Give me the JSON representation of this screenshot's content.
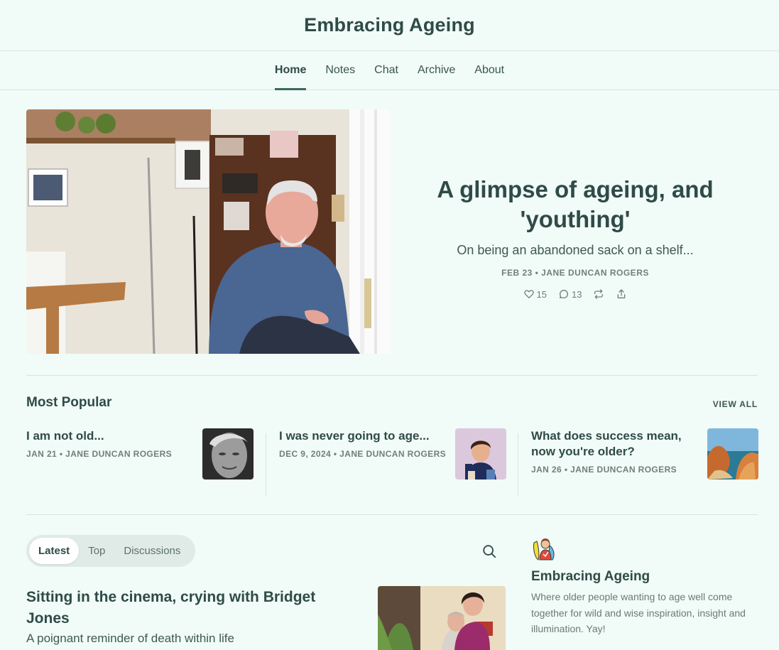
{
  "header": {
    "title": "Embracing Ageing"
  },
  "nav": {
    "items": [
      {
        "label": "Home",
        "active": true
      },
      {
        "label": "Notes"
      },
      {
        "label": "Chat"
      },
      {
        "label": "Archive"
      },
      {
        "label": "About"
      }
    ]
  },
  "hero": {
    "title": "A glimpse of ageing, and 'youthing'",
    "subtitle": "On being an abandoned sack on a shelf...",
    "meta": "FEB 23 • JANE DUNCAN ROGERS",
    "likes": "15",
    "comments": "13",
    "icons": [
      "heart-icon",
      "comment-icon",
      "restack-icon",
      "share-icon"
    ]
  },
  "popular": {
    "heading": "Most Popular",
    "view_all": "VIEW ALL",
    "posts": [
      {
        "title": "I am not old...",
        "meta": "JAN 21 • JANE DUNCAN ROGERS"
      },
      {
        "title": "I was never going to age...",
        "meta": "DEC 9, 2024 • JANE DUNCAN ROGERS"
      },
      {
        "title": "What does success mean, now you're older?",
        "meta": "JAN 26 • JANE DUNCAN ROGERS"
      }
    ]
  },
  "feed": {
    "tabs": [
      {
        "label": "Latest",
        "active": true
      },
      {
        "label": "Top"
      },
      {
        "label": "Discussions"
      }
    ],
    "post": {
      "title": "Sitting in the cinema, crying with Bridget Jones",
      "subtitle": "A poignant reminder of death within life"
    }
  },
  "about": {
    "title": "Embracing Ageing",
    "description": "Where older people wanting to age well come together for wild and wise inspiration, insight and illumination. Yay!"
  },
  "colors": {
    "background": "#f1fbf7",
    "text": "#2f4b47",
    "muted": "#6f807c",
    "accent": "#3d6660"
  }
}
